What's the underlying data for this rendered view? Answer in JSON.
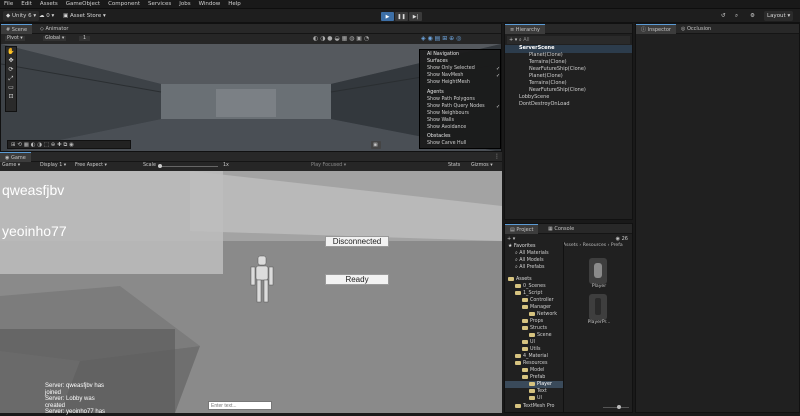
{
  "menubar": [
    "File",
    "Edit",
    "Assets",
    "GameObject",
    "Component",
    "Services",
    "Jobs",
    "Window",
    "Help"
  ],
  "toolbar": {
    "account": "Unity 6",
    "cloud_label": "0",
    "asset_store": "Asset Store",
    "layout": "Layout"
  },
  "scene_panel": {
    "tabs": [
      "Scene",
      "Animator"
    ],
    "shading": "Pivot",
    "space": "Global",
    "grid_value": "1",
    "overlay": {
      "sections": [
        {
          "title": "AI Navigation",
          "items": []
        },
        {
          "title": "Surfaces",
          "items": [
            {
              "label": "Show Only Selected",
              "checked": true
            },
            {
              "label": "Show NavMesh",
              "checked": true
            },
            {
              "label": "Show HeightMesh",
              "checked": false
            }
          ]
        },
        {
          "title": "Agents",
          "items": [
            {
              "label": "Show Path Polygons",
              "checked": false
            },
            {
              "label": "Show Path Query Nodes",
              "checked": true
            },
            {
              "label": "Show Neighbours",
              "checked": false
            },
            {
              "label": "Show Walls",
              "checked": false
            },
            {
              "label": "Show Avoidance",
              "checked": false
            }
          ]
        },
        {
          "title": "Obstacles",
          "items": [
            {
              "label": "Show Carve Hull",
              "checked": false
            }
          ]
        }
      ]
    }
  },
  "game_panel": {
    "tab": "Game",
    "display": "Game",
    "display_num": "Display 1",
    "aspect": "Free Aspect",
    "scale_label": "Scale",
    "scale_value": "1x",
    "play_focused": "Play Focused",
    "stats": "Stats",
    "gizmos": "Gizmos",
    "player1": "qweasfjbv",
    "player2": "yeoinho77",
    "status_button": "Disconnected",
    "ready_button": "Ready",
    "chat_lines": [
      "Server: qweasfjbv has",
      "joined",
      "Server: Lobby was",
      "created",
      "Server: yeoinho77 has"
    ],
    "chat_placeholder": "Enter text..."
  },
  "hierarchy": {
    "tab": "Hierarchy",
    "search_placeholder": "All",
    "items": [
      {
        "label": "ServerScene",
        "indent": 0,
        "scene": true
      },
      {
        "label": "Planet(Clone)",
        "indent": 1
      },
      {
        "label": "Terrains(Clone)",
        "indent": 1
      },
      {
        "label": "NearFutureShip(Clone)",
        "indent": 1
      },
      {
        "label": "Planet(Clone)",
        "indent": 1
      },
      {
        "label": "Terrains(Clone)",
        "indent": 1
      },
      {
        "label": "NearFutureShip(Clone)",
        "indent": 1
      },
      {
        "label": "LobbyScene",
        "indent": 0,
        "scene": true
      },
      {
        "label": "DontDestroyOnLoad",
        "indent": 0,
        "scene": true
      }
    ]
  },
  "inspector": {
    "tabs": [
      "Inspector",
      "Occlusion"
    ]
  },
  "project": {
    "tabs": [
      "Project",
      "Console"
    ],
    "count": "26",
    "breadcrumb": "Assets › Resources › Prefa",
    "favorites": [
      "Favorites",
      "All Materials",
      "All Models",
      "All Prefabs"
    ],
    "tree": [
      {
        "label": "Assets",
        "indent": 0
      },
      {
        "label": "0_Scenes",
        "indent": 1
      },
      {
        "label": "1_Script",
        "indent": 1
      },
      {
        "label": "Controller",
        "indent": 2
      },
      {
        "label": "Manager",
        "indent": 2
      },
      {
        "label": "Network",
        "indent": 3
      },
      {
        "label": "Props",
        "indent": 2
      },
      {
        "label": "Structs",
        "indent": 2
      },
      {
        "label": "Scene",
        "indent": 3
      },
      {
        "label": "UI",
        "indent": 2
      },
      {
        "label": "Utils",
        "indent": 2
      },
      {
        "label": "4_Material",
        "indent": 1
      },
      {
        "label": "Resources",
        "indent": 1
      },
      {
        "label": "Model",
        "indent": 2
      },
      {
        "label": "Prefab",
        "indent": 2
      },
      {
        "label": "Player",
        "indent": 3
      },
      {
        "label": "Text",
        "indent": 3
      },
      {
        "label": "UI",
        "indent": 3
      },
      {
        "label": "TextMesh Pro",
        "indent": 1
      }
    ],
    "assets": [
      "Player",
      "PlayerPr..."
    ]
  },
  "colors": {
    "accent": "#5b9bd5",
    "game_sky": "#9a9a9a",
    "panel_bg": "#202020"
  }
}
